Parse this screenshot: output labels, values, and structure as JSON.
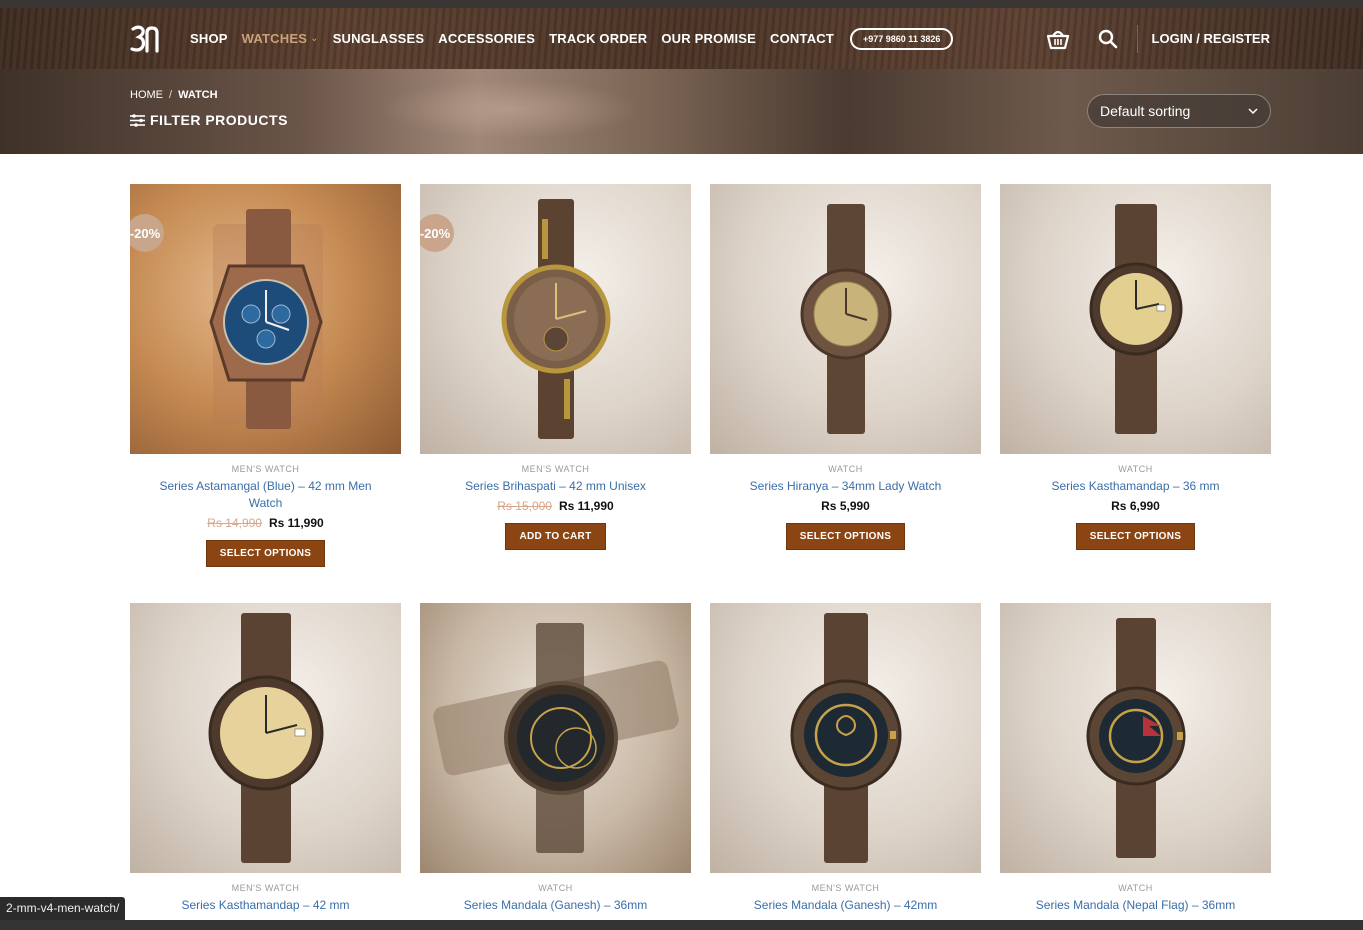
{
  "header": {
    "nav": [
      {
        "label": "SHOP"
      },
      {
        "label": "WATCHES",
        "active": true
      },
      {
        "label": "SUNGLASSES"
      },
      {
        "label": "ACCESSORIES"
      },
      {
        "label": "TRACK ORDER"
      },
      {
        "label": "OUR PROMISE"
      },
      {
        "label": "CONTACT"
      }
    ],
    "phone": "+977 9860 11 3826",
    "login": "LOGIN / REGISTER",
    "logo_text": "3n"
  },
  "banner": {
    "breadcrumb_home": "HOME",
    "breadcrumb_sep": "/",
    "breadcrumb_current": "WATCH",
    "filter_label": "FILTER PRODUCTS",
    "sorting": "Default sorting"
  },
  "products": [
    {
      "category": "MEN'S WATCH",
      "title": "Series Astamangal (Blue) – 42 mm Men Watch",
      "old_price": "Rs 14,990",
      "price": "Rs 11,990",
      "badge": "-20%",
      "button": "SELECT OPTIONS"
    },
    {
      "category": "MEN'S WATCH",
      "title": "Series Brihaspati – 42 mm Unisex",
      "old_price": "Rs 15,000",
      "price": "Rs 11,990",
      "badge": "-20%",
      "button": "ADD TO CART"
    },
    {
      "category": "WATCH",
      "title": "Series Hiranya – 34mm Lady Watch",
      "old_price": "",
      "price": "Rs 5,990",
      "badge": "",
      "button": "SELECT OPTIONS"
    },
    {
      "category": "WATCH",
      "title": "Series Kasthamandap – 36 mm",
      "old_price": "",
      "price": "Rs 6,990",
      "badge": "",
      "button": "SELECT OPTIONS"
    },
    {
      "category": "MEN'S WATCH",
      "title": "Series Kasthamandap – 42 mm",
      "old_price": "",
      "price": "",
      "badge": "",
      "button": ""
    },
    {
      "category": "WATCH",
      "title": "Series Mandala (Ganesh) – 36mm",
      "old_price": "",
      "price": "",
      "badge": "",
      "button": ""
    },
    {
      "category": "MEN'S WATCH",
      "title": "Series Mandala (Ganesh) – 42mm",
      "old_price": "",
      "price": "",
      "badge": "",
      "button": ""
    },
    {
      "category": "WATCH",
      "title": "Series Mandala (Nepal Flag) – 36mm",
      "old_price": "",
      "price": "",
      "badge": "",
      "button": ""
    }
  ],
  "status_url": "2-mm-v4-men-watch/",
  "colors": {
    "accent": "#8b4513",
    "link": "#3a6ea8",
    "badge": "#c9a58b",
    "active_nav": "#c9a27a"
  }
}
